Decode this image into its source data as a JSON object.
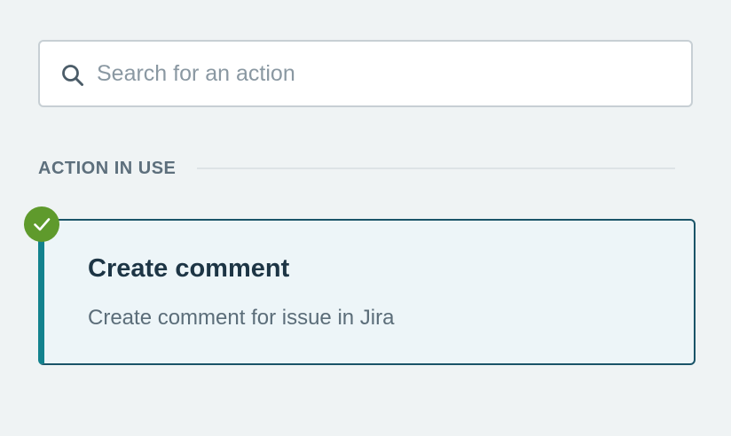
{
  "search": {
    "placeholder": "Search for an action",
    "value": "",
    "icon": "search-icon"
  },
  "section": {
    "title": "ACTION IN USE"
  },
  "action_card": {
    "title": "Create comment",
    "description": "Create comment for issue in Jira",
    "status_icon": "check-circle-icon",
    "status": "in use"
  },
  "colors": {
    "background": "#eff3f4",
    "accent_teal": "#13828e",
    "card_border": "#1a5468",
    "card_background": "#edf5f8",
    "check_green": "#5f9a2c",
    "section_title": "#5d6f7c"
  }
}
